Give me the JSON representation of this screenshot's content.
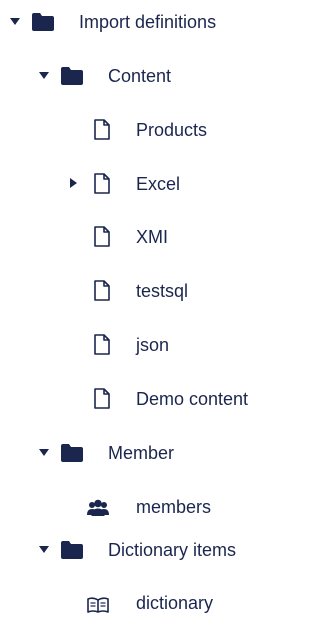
{
  "tree": {
    "import_definitions": {
      "label": "Import definitions",
      "icon": "folder-icon",
      "expanded": true
    },
    "content": {
      "label": "Content",
      "icon": "folder-icon",
      "expanded": true,
      "items": [
        {
          "label": "Products",
          "icon": "document-icon"
        },
        {
          "label": "Excel",
          "icon": "document-icon",
          "has_children": true,
          "expanded": false
        },
        {
          "label": "XMI",
          "icon": "document-icon"
        },
        {
          "label": "testsql",
          "icon": "document-icon"
        },
        {
          "label": "json",
          "icon": "document-icon"
        },
        {
          "label": "Demo content",
          "icon": "document-icon"
        }
      ]
    },
    "member": {
      "label": "Member",
      "icon": "folder-icon",
      "expanded": true,
      "items": [
        {
          "label": "members",
          "icon": "users-icon"
        }
      ]
    },
    "dictionary_items": {
      "label": "Dictionary items",
      "icon": "folder-icon",
      "expanded": true,
      "items": [
        {
          "label": "dictionary",
          "icon": "book-icon"
        }
      ]
    }
  },
  "colors": {
    "text": "#1b264f",
    "icon": "#1b264f",
    "background": "#ffffff"
  }
}
